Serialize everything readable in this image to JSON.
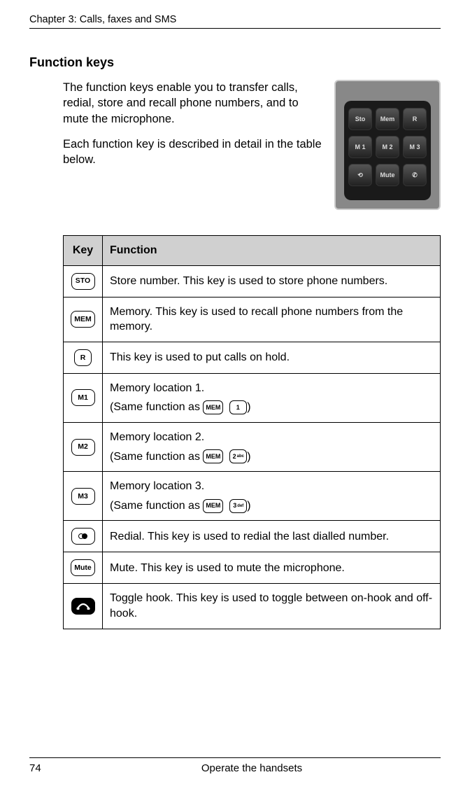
{
  "chapter_header": "Chapter 3:  Calls, faxes and SMS",
  "section_heading": "Function keys",
  "intro_p1": "The function keys enable you to transfer calls, redial, store and recall phone numbers, and to mute the microphone.",
  "intro_p2": "Each function key is described in detail in the table below.",
  "handset_keys": {
    "r1": [
      "Sto",
      "Mem",
      "R"
    ],
    "r2": [
      "M 1",
      "M 2",
      "M 3"
    ],
    "r3": [
      "⟲",
      "Mute",
      "✆"
    ]
  },
  "table": {
    "head_key": "Key",
    "head_func": "Function",
    "rows": [
      {
        "key_label": "STO",
        "desc": "Store number. This key is used to store phone numbers."
      },
      {
        "key_label": "MEM",
        "desc": "Memory. This key is used to recall phone numbers from the memory."
      },
      {
        "key_label": "R",
        "desc": "This key is used to put calls on hold."
      },
      {
        "key_label": "M1",
        "desc_line1": "Memory location 1.",
        "same_as_prefix": "(Same function as ",
        "same_as_suffix": ")",
        "mem": "MEM",
        "num": "1",
        "num_sub": ""
      },
      {
        "key_label": "M2",
        "desc_line1": "Memory location 2.",
        "same_as_prefix": "(Same function as ",
        "same_as_suffix": ")",
        "mem": "MEM",
        "num": "2",
        "num_sub": "abc"
      },
      {
        "key_label": "M3",
        "desc_line1": "Memory location 3.",
        "same_as_prefix": "(Same function as ",
        "same_as_suffix": ")",
        "mem": "MEM",
        "num": "3",
        "num_sub": "def"
      },
      {
        "key_label": "REDIAL",
        "desc": "Redial. This key is used to redial the last dialled number."
      },
      {
        "key_label": "Mute",
        "desc": "Mute. This key is used to mute the microphone."
      },
      {
        "key_label": "HOOK",
        "desc": "Toggle hook. This key is used to toggle between on-hook and off-hook."
      }
    ]
  },
  "footer": {
    "page": "74",
    "title": "Operate the handsets"
  }
}
